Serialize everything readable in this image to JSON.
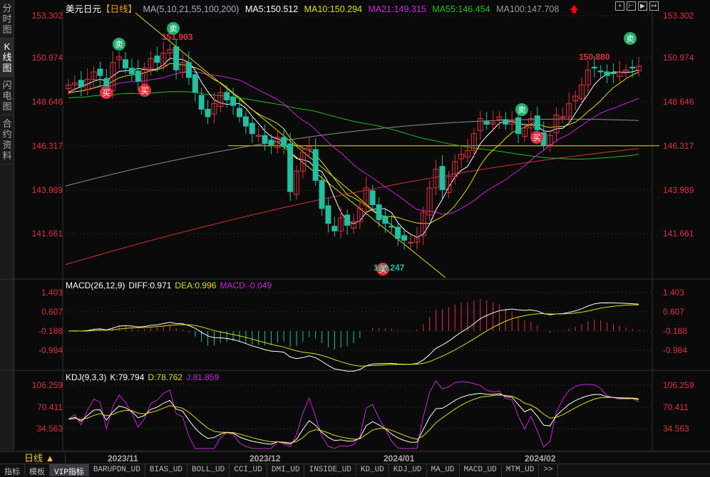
{
  "sidebar": {
    "items": [
      "分时图",
      "K线图",
      "闪电图",
      "合约资料"
    ]
  },
  "header": {
    "symbol": "美元日元",
    "period_tag": "【日线】",
    "ma_params": "MA(5,10,21,55,100,200)",
    "ma5": "MA5:150.512",
    "ma10": "MA10:150.294",
    "ma21": "MA21:149.315",
    "ma55": "MA55:146.454",
    "ma100": "MA100:147.708",
    "arrow": "🡅"
  },
  "toolbar": {
    "icons": [
      "crosshair-icon",
      "zoom-fit-icon",
      "play-icon",
      "move-right-icon"
    ]
  },
  "price_axis": [
    "153.302",
    "150.974",
    "148.646",
    "146.317",
    "143.989",
    "141.661"
  ],
  "annotations": {
    "high": "151.903",
    "recent_high": "150.880",
    "low": "140.247",
    "buy": "买",
    "sell": "卖"
  },
  "macd": {
    "label": "MACD(26,12,9)",
    "diff": "DIFF:0.971",
    "dea": "DEA:0.996",
    "macd": "MACD:-0.049",
    "axis": [
      "1.403",
      "0.607",
      "-0.188",
      "-0.984"
    ]
  },
  "kdj": {
    "label": "KDJ(9,3,3)",
    "k": "K:79.794",
    "d": "D:78.762",
    "j": "J:81.859",
    "axis": [
      "106.259",
      "70.411",
      "34.563"
    ]
  },
  "period": "日线 ▲",
  "dates": [
    "2023/11",
    "2023/12",
    "2024/01",
    "2024/02"
  ],
  "tabs": [
    "指标",
    "模板",
    "VIP指标",
    "BARUPDN_UD",
    "BIAS_UD",
    "BOLL_UD",
    "CCI_UD",
    "DMI_UD",
    "INSIDE_UD",
    "KD_UD",
    "KDJ_UD",
    "MA_UD",
    "MACD_UD",
    "MTM_UD",
    ">>"
  ],
  "colors": {
    "ma5": "#ffffff",
    "ma10": "#e0e000",
    "ma21": "#d020e0",
    "ma55": "#20c020",
    "ma100": "#909090",
    "ma200": "#e03030",
    "up": "#e03040",
    "down": "#20c0a0"
  },
  "chart_data": {
    "type": "candlestick",
    "ylim": [
      140.0,
      153.302
    ],
    "closes": [
      149.6,
      149.7,
      149.5,
      149.9,
      150.3,
      150.1,
      149.3,
      150.8,
      151.1,
      150.5,
      150.2,
      149.8,
      150.5,
      151.0,
      150.8,
      151.3,
      151.5,
      150.4,
      150.8,
      150.0,
      149.2,
      148.3,
      147.9,
      148.6,
      149.2,
      148.8,
      148.5,
      147.9,
      147.4,
      147.0,
      146.9,
      146.5,
      146.4,
      146.8,
      146.3,
      143.9,
      145.0,
      146.0,
      146.3,
      144.5,
      143.0,
      142.2,
      141.8,
      142.5,
      142.1,
      142.3,
      143.0,
      144.1,
      143.2,
      142.4,
      142.2,
      142.0,
      141.4,
      141.3,
      141.2,
      141.4,
      142.8,
      144.1,
      145.1,
      144.0,
      144.7,
      145.5,
      145.9,
      146.1,
      147.0,
      147.8,
      147.5,
      147.6,
      147.9,
      147.5,
      147.7,
      147.0,
      147.3,
      147.8,
      147.2,
      146.4,
      146.9,
      148.0,
      147.9,
      148.6,
      149.0,
      149.6,
      150.4,
      150.5,
      150.3,
      150.1,
      150.2,
      150.3,
      150.4,
      150.5,
      150.6
    ],
    "ma100": [
      144.2,
      147.7
    ],
    "ma200": [
      140.0,
      146.2
    ],
    "hline": 146.35
  }
}
